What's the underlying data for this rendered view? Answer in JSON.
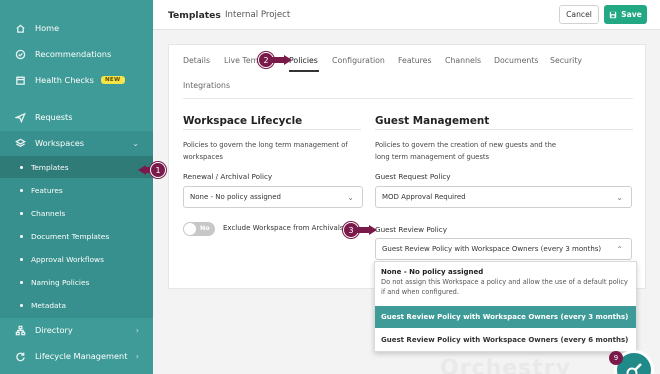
{
  "sidebar": {
    "items": [
      {
        "label": "Home",
        "icon": "home-icon"
      },
      {
        "label": "Recommendations",
        "icon": "check-circle-icon"
      },
      {
        "label": "Health Checks",
        "icon": "calendar-icon",
        "badge": "NEW"
      },
      {
        "label": "Requests",
        "icon": "send-icon"
      },
      {
        "label": "Workspaces",
        "icon": "layers-icon"
      },
      {
        "label": "Directory",
        "icon": "hierarchy-icon"
      },
      {
        "label": "Lifecycle Management",
        "icon": "refresh-icon"
      }
    ],
    "sub_items": [
      {
        "label": "Templates"
      },
      {
        "label": "Features"
      },
      {
        "label": "Channels"
      },
      {
        "label": "Document Templates"
      },
      {
        "label": "Approval Workflows"
      },
      {
        "label": "Naming Policies"
      },
      {
        "label": "Metadata"
      }
    ]
  },
  "header": {
    "title": "Templates",
    "subtitle": "Internal Project",
    "cancel_label": "Cancel",
    "save_label": "Save"
  },
  "tabs": [
    {
      "label": "Details"
    },
    {
      "label": "Live Temp"
    },
    {
      "label": "Policies"
    },
    {
      "label": "Configuration"
    },
    {
      "label": "Features"
    },
    {
      "label": "Channels"
    },
    {
      "label": "Documents"
    },
    {
      "label": "Security"
    },
    {
      "label": "Integrations"
    }
  ],
  "lifecycle": {
    "title": "Workspace Lifecycle",
    "description": "Policies to govern the long term management of workspaces",
    "renewal_label": "Renewal / Archival Policy",
    "renewal_value": "None - No policy assigned",
    "toggle_state": "No",
    "toggle_label": "Exclude Workspace from Archivals"
  },
  "guest": {
    "title": "Guest Management",
    "description": "Policies to govern the creation of new guests and the long term management of guests",
    "request_label": "Guest Request Policy",
    "request_value": "MOD Approval Required",
    "review_label": "Guest Review Policy",
    "review_value": "Guest Review Policy with Workspace Owners (every 3 months)"
  },
  "dropdown": {
    "none_title": "None - No policy assigned",
    "none_desc": "Do not assign this Workspace a policy and allow the use of a default policy if and when configured.",
    "option_1": "Guest Review Policy with Workspace Owners (every 3 months)",
    "option_2": "Guest Review Policy with Workspace Owners (every 6 months)"
  },
  "callouts": [
    "1",
    "2",
    "3"
  ],
  "watermark": "Orchestry",
  "help_badge": "9",
  "colors": {
    "sidebar": "#3f9b98",
    "accent": "#23a884",
    "callout": "#7a1a4a"
  }
}
